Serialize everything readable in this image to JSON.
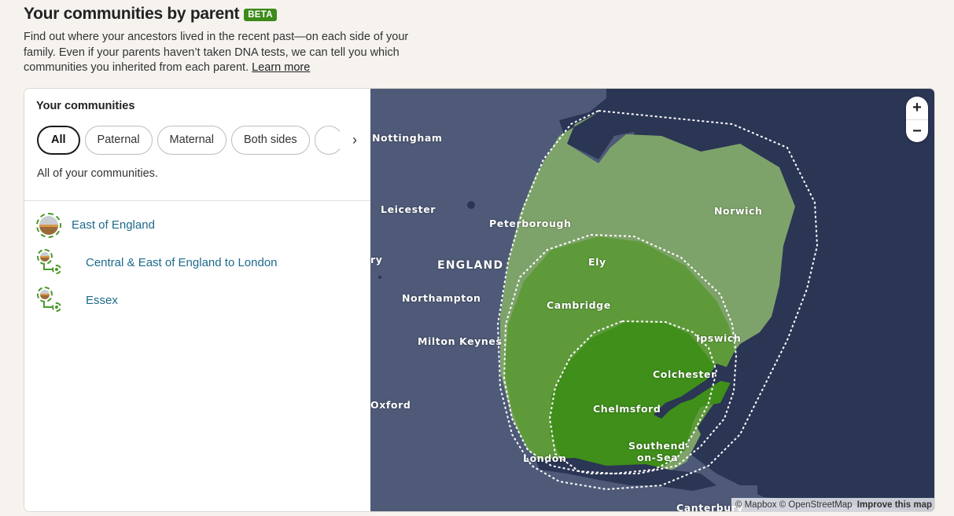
{
  "header": {
    "title": "Your communities by parent",
    "badge": "BETA",
    "description": "Find out where your ancestors lived in the recent past—on each side of your family. Even if your parents haven’t taken DNA tests, we can tell you which communities you inherited from each parent.",
    "learn_more": "Learn more"
  },
  "panel": {
    "title": "Your communities",
    "filters": [
      "All",
      "Paternal",
      "Maternal",
      "Both sides"
    ],
    "active_filter": "All",
    "next_icon": "chevron-right-icon",
    "next_glyph": "›",
    "filter_description": "All of your communities.",
    "communities": [
      {
        "label": "East of England",
        "icon": "community-avatar-icon"
      },
      {
        "label": "Central & East of England to London",
        "icon": "sub-community-icon"
      },
      {
        "label": "Essex",
        "icon": "sub-community-icon"
      }
    ]
  },
  "map": {
    "colors": {
      "sea": "#2b3554",
      "land": "#4e5a78",
      "region_outer": "#7ea36a",
      "region_middle": "#5e9a3a",
      "region_inner": "#3f8f1a"
    },
    "places": {
      "nottingham": "Nottingham",
      "leicester": "Leicester",
      "peterborough": "Peterborough",
      "norwich": "Norwich",
      "england": "ENGLAND",
      "ely": "Ely",
      "ry": "ry",
      "northampton": "Northampton",
      "cambridge": "Cambridge",
      "milton_keynes": "Milton Keynes",
      "ipswich": "Ipswich",
      "colchester": "Colchester",
      "oxford": "Oxford",
      "chelmsford": "Chelmsford",
      "southend_1": "Southend-",
      "southend_2": "on-Sea",
      "london": "London",
      "canterbury": "Canterbury"
    },
    "zoom_in": "+",
    "zoom_out": "−",
    "attribution": {
      "mapbox": "© Mapbox",
      "osm": "© OpenStreetMap",
      "improve": "Improve this map"
    }
  }
}
